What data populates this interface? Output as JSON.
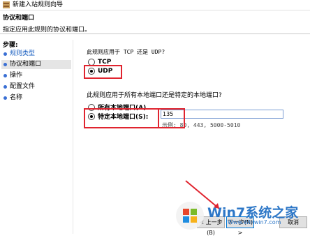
{
  "window": {
    "title": "新建入站规则向导"
  },
  "header": {
    "title": "协议和端口",
    "description": "指定应用此规则的协议和端口。"
  },
  "sidebar": {
    "title": "步骤:",
    "items": [
      {
        "label": "规则类型",
        "state": "done"
      },
      {
        "label": "协议和端口",
        "state": "current"
      },
      {
        "label": "操作",
        "state": "pending"
      },
      {
        "label": "配置文件",
        "state": "pending"
      },
      {
        "label": "名称",
        "state": "pending"
      }
    ]
  },
  "main": {
    "protocol_question": "此规则应用于 TCP 还是 UDP?",
    "tcp_label": "TCP",
    "udp_label": "UDP",
    "selected_protocol": "UDP",
    "port_question": "此规则应用于所有本地端口还是特定的本地端口?",
    "all_ports_label": "所有本地端口(A)",
    "specific_ports_label": "特定本地端口(S):",
    "port_value": "135",
    "example_text": "示例: 80, 443, 5000-5010"
  },
  "buttons": {
    "back": "< 上一步(B)",
    "next": "下一步(N) >",
    "cancel": "取消"
  },
  "watermark": {
    "brand": "Win7系统之家",
    "url": "Www.Winwin7.com"
  },
  "colors": {
    "highlight": "#e0242f",
    "link": "#1a5fc0",
    "accent": "#3a6fd4"
  }
}
